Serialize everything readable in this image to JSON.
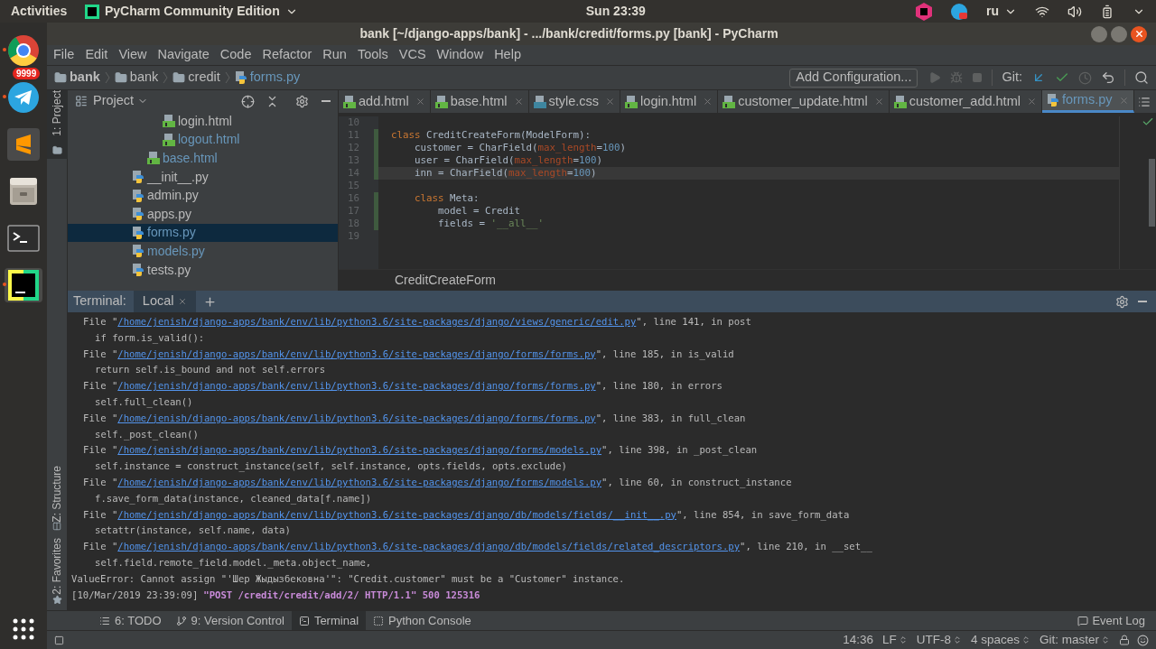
{
  "top_bar": {
    "activities": "Activities",
    "app_menu": "PyCharm Community Edition",
    "clock": "Sun 23:39",
    "keyboard_layout": "ru"
  },
  "dock": [
    {
      "kind": "browser",
      "running": true,
      "selected": false
    },
    {
      "kind": "messenger",
      "running": true,
      "selected": false,
      "badge": "9999"
    },
    {
      "kind": "editor",
      "running": false,
      "selected": false
    },
    {
      "kind": "files",
      "running": false,
      "selected": false
    },
    {
      "kind": "terminal",
      "running": false,
      "selected": false
    },
    {
      "kind": "ide",
      "running": true,
      "selected": true
    }
  ],
  "window": {
    "title": "bank [~/django-apps/bank] - .../bank/credit/forms.py [bank] - PyCharm"
  },
  "menu": [
    "File",
    "Edit",
    "View",
    "Navigate",
    "Code",
    "Refactor",
    "Run",
    "Tools",
    "VCS",
    "Window",
    "Help"
  ],
  "breadcrumbs": [
    {
      "label": "bank",
      "kind": "project"
    },
    {
      "label": "bank",
      "kind": "folder"
    },
    {
      "label": "credit",
      "kind": "folder"
    },
    {
      "label": "forms.py",
      "kind": "file"
    }
  ],
  "toolbar": {
    "run_configuration": "Add Configuration...",
    "git_label": "Git:"
  },
  "left_stripe": [
    {
      "label": "1: Project",
      "selected": true,
      "kind": "project"
    }
  ],
  "left_stripe_bottom": [
    {
      "label": "Z: Structure",
      "kind": "structure"
    },
    {
      "label": "2: Favorites",
      "kind": "favorites"
    }
  ],
  "project": {
    "title": "Project",
    "tree": [
      {
        "children": [
          {
            "children": [
              {
                "label": "login.html",
                "kind": "html",
                "modified": false,
                "selected": false
              },
              {
                "label": "logout.html",
                "kind": "html",
                "modified": true,
                "selected": false
              }
            ]
          },
          {
            "label": "base.html",
            "kind": "html",
            "modified": true,
            "selected": false
          }
        ]
      },
      {
        "label": "__init__.py",
        "kind": "python",
        "modified": false,
        "selected": false
      },
      {
        "label": "admin.py",
        "kind": "python",
        "modified": false,
        "selected": false
      },
      {
        "label": "apps.py",
        "kind": "python",
        "modified": false,
        "selected": false
      },
      {
        "label": "forms.py",
        "kind": "python",
        "modified": true,
        "selected": true
      },
      {
        "label": "models.py",
        "kind": "python",
        "modified": true,
        "selected": false
      },
      {
        "label": "tests.py",
        "kind": "python",
        "modified": false,
        "selected": false
      }
    ]
  },
  "editor_tabs": [
    {
      "label": "add.html",
      "kind": "html",
      "selected": false
    },
    {
      "label": "base.html",
      "kind": "html",
      "selected": false
    },
    {
      "label": "style.css",
      "kind": "css",
      "selected": false
    },
    {
      "label": "login.html",
      "kind": "html",
      "selected": false
    },
    {
      "label": "customer_update.html",
      "kind": "html",
      "selected": false
    },
    {
      "label": "customer_add.html",
      "kind": "html",
      "selected": false
    },
    {
      "label": "forms.py",
      "kind": "python",
      "selected": true
    }
  ],
  "code": [
    {
      "number": "10"
    },
    {
      "number": "11",
      "current": false,
      "changed": true,
      "tokens": [
        {
          "kind": "keyword",
          "text": "class"
        },
        {
          "kind": "plain",
          "text": " CreditCreateForm(ModelForm):"
        }
      ]
    },
    {
      "number": "12",
      "current": false,
      "changed": true,
      "tokens": [
        {
          "kind": "plain",
          "text": "    customer = CharField("
        },
        {
          "kind": "param",
          "text": "max_length"
        },
        {
          "kind": "plain",
          "text": "="
        },
        {
          "kind": "number",
          "text": "100"
        },
        {
          "kind": "plain",
          "text": ")"
        }
      ]
    },
    {
      "number": "13",
      "current": false,
      "changed": true,
      "tokens": [
        {
          "kind": "plain",
          "text": "    user = CharField("
        },
        {
          "kind": "param",
          "text": "max_length"
        },
        {
          "kind": "plain",
          "text": "="
        },
        {
          "kind": "number",
          "text": "100"
        },
        {
          "kind": "plain",
          "text": ")"
        }
      ]
    },
    {
      "number": "14",
      "current": true,
      "changed": true,
      "tokens": [
        {
          "kind": "plain",
          "text": "    inn = CharField("
        },
        {
          "kind": "param",
          "text": "max_length"
        },
        {
          "kind": "plain",
          "text": "="
        },
        {
          "kind": "number",
          "text": "100"
        },
        {
          "kind": "plain",
          "text": ")"
        }
      ]
    },
    {
      "number": "15"
    },
    {
      "number": "16",
      "current": false,
      "changed": true,
      "tokens": [
        {
          "kind": "keyword",
          "text": "    class"
        },
        {
          "kind": "plain",
          "text": " Meta:"
        }
      ]
    },
    {
      "number": "17",
      "current": false,
      "changed": true,
      "tokens": [
        {
          "kind": "plain",
          "text": "        model = Credit"
        }
      ]
    },
    {
      "number": "18",
      "current": false,
      "changed": true,
      "tokens": [
        {
          "kind": "plain",
          "text": "        fields = "
        },
        {
          "kind": "string",
          "text": "'__all__'"
        }
      ]
    },
    {
      "number": "19"
    }
  ],
  "editor_breadcrumb": "CreditCreateForm",
  "terminal": {
    "label": "Terminal:",
    "tabs": [
      {
        "label": "Local",
        "selected": true
      }
    ],
    "lines": [
      {
        "kind": "frame",
        "prefix": "File \"",
        "link": "/home/jenish/django-apps/bank/env/lib/python3.6/site-packages/django/views/generic/edit.py",
        "suffix": "\", line 141, in post"
      },
      {
        "kind": "source",
        "text": "if form.is_valid():"
      },
      {
        "kind": "frame",
        "prefix": "File \"",
        "link": "/home/jenish/django-apps/bank/env/lib/python3.6/site-packages/django/forms/forms.py",
        "suffix": "\", line 185, in is_valid"
      },
      {
        "kind": "source",
        "text": "return self.is_bound and not self.errors"
      },
      {
        "kind": "frame",
        "prefix": "File \"",
        "link": "/home/jenish/django-apps/bank/env/lib/python3.6/site-packages/django/forms/forms.py",
        "suffix": "\", line 180, in errors"
      },
      {
        "kind": "source",
        "text": "self.full_clean()"
      },
      {
        "kind": "frame",
        "prefix": "File \"",
        "link": "/home/jenish/django-apps/bank/env/lib/python3.6/site-packages/django/forms/forms.py",
        "suffix": "\", line 383, in full_clean"
      },
      {
        "kind": "source",
        "text": "self._post_clean()"
      },
      {
        "kind": "frame",
        "prefix": "File \"",
        "link": "/home/jenish/django-apps/bank/env/lib/python3.6/site-packages/django/forms/models.py",
        "suffix": "\", line 398, in _post_clean"
      },
      {
        "kind": "source",
        "text": "self.instance = construct_instance(self, self.instance, opts.fields, opts.exclude)"
      },
      {
        "kind": "frame",
        "prefix": "File \"",
        "link": "/home/jenish/django-apps/bank/env/lib/python3.6/site-packages/django/forms/models.py",
        "suffix": "\", line 60, in construct_instance"
      },
      {
        "kind": "source",
        "text": "f.save_form_data(instance, cleaned_data[f.name])"
      },
      {
        "kind": "frame",
        "prefix": "File \"",
        "link": "/home/jenish/django-apps/bank/env/lib/python3.6/site-packages/django/db/models/fields/__init__.py",
        "suffix": "\", line 854, in save_form_data"
      },
      {
        "kind": "source",
        "text": "setattr(instance, self.name, data)"
      },
      {
        "kind": "frame",
        "prefix": "File \"",
        "link": "/home/jenish/django-apps/bank/env/lib/python3.6/site-packages/django/db/models/fields/related_descriptors.py",
        "suffix": "\", line 210, in __set__"
      },
      {
        "kind": "source",
        "text": "self.field.remote_field.model._meta.object_name,"
      },
      {
        "kind": "error",
        "text": "ValueError: Cannot assign \"'Шер Жыдызбековна'\": \"Credit.customer\" must be a \"Customer\" instance."
      },
      {
        "kind": "log",
        "time": "[10/Mar/2019 23:39:09]",
        "request": "\"POST /credit/credit/add/2/ HTTP/1.1\" 500 125316"
      }
    ]
  },
  "bottom_tools": [
    {
      "label": "6: TODO",
      "kind": "todo",
      "selected": false
    },
    {
      "label": "9: Version Control",
      "kind": "vcs",
      "selected": false
    },
    {
      "label": "Terminal",
      "kind": "terminal",
      "selected": true
    },
    {
      "label": "Python Console",
      "kind": "console",
      "selected": false
    }
  ],
  "event_log": "Event Log",
  "status_bar": [
    {
      "label": "14:36",
      "kind": "text"
    },
    {
      "label": "LF",
      "kind": "choice"
    },
    {
      "label": "UTF-8",
      "kind": "choice"
    },
    {
      "label": "4 spaces",
      "kind": "choice"
    },
    {
      "label": "Git: master",
      "kind": "choice"
    }
  ]
}
